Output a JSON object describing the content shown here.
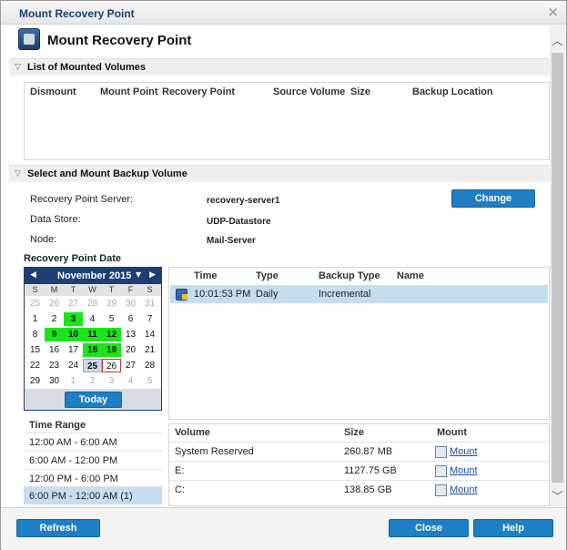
{
  "window": {
    "title": "Mount Recovery Point",
    "close_glyph": "×"
  },
  "header": {
    "title": "Mount Recovery Point",
    "icon": "recovery-point-icon"
  },
  "mounted_section": {
    "title": "List of Mounted Volumes",
    "columns": [
      "Dismount",
      "Mount Point",
      "Recovery Point",
      "Source Volume",
      "Size",
      "Backup Location"
    ]
  },
  "select_section": {
    "title": "Select and Mount Backup Volume",
    "labels": {
      "server": "Recovery Point Server:",
      "datastore": "Data Store:",
      "node": "Node:"
    },
    "values": {
      "server": "recovery-server1",
      "datastore": "UDP-Datastore",
      "node": "Mail-Server"
    },
    "change_label": "Change"
  },
  "calendar": {
    "section_label": "Recovery Point Date",
    "month": "November 2015",
    "prev_glyph": "◀",
    "next_glyph": "▶",
    "dropdown_glyph": "▼",
    "dow": [
      "S",
      "M",
      "T",
      "W",
      "T",
      "F",
      "S"
    ],
    "weeks": [
      [
        "25",
        "26",
        "27",
        "28",
        "29",
        "30",
        "31"
      ],
      [
        "1",
        "2",
        "3",
        "4",
        "5",
        "6",
        "7"
      ],
      [
        "8",
        "9",
        "10",
        "11",
        "12",
        "13",
        "14"
      ],
      [
        "15",
        "16",
        "17",
        "18",
        "19",
        "20",
        "21"
      ],
      [
        "22",
        "23",
        "24",
        "25",
        "26",
        "27",
        "28"
      ],
      [
        "29",
        "30",
        "1",
        "2",
        "3",
        "4",
        "5"
      ]
    ],
    "today_label": "Today"
  },
  "time_range": {
    "label": "Time Range",
    "items": [
      "12:00 AM - 6:00 AM",
      "6:00 AM - 12:00 PM",
      "12:00 PM - 6:00 PM",
      "6:00 PM - 12:00 AM   (1)"
    ]
  },
  "recovery_points": {
    "columns": [
      "Time",
      "Type",
      "Backup Type",
      "Name"
    ],
    "rows": [
      {
        "time": "10:01:53 PM",
        "type": "Daily",
        "backup_type": "Incremental",
        "name": ""
      }
    ]
  },
  "volumes": {
    "columns": [
      "Volume",
      "Size",
      "Mount"
    ],
    "rows": [
      {
        "volume": "System Reserved",
        "size": "260.87 MB",
        "mount": "Mount"
      },
      {
        "volume": "E:",
        "size": "1127.75 GB",
        "mount": "Mount"
      },
      {
        "volume": "C:",
        "size": "138.85 GB",
        "mount": "Mount"
      }
    ]
  },
  "footer": {
    "refresh": "Refresh",
    "close": "Close",
    "help": "Help"
  },
  "scrollbar": {
    "up_glyph": "︿",
    "down_glyph": "﹀"
  },
  "colors": {
    "accent": "#1e7fc4",
    "calendar_header": "#1e3f73",
    "backup_day": "#19e619",
    "selection": "#c6ddf0"
  }
}
